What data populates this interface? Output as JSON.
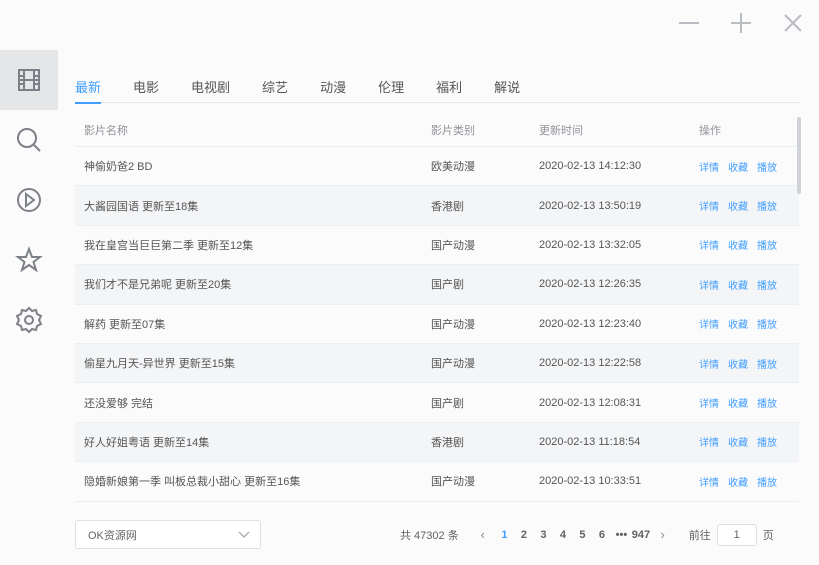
{
  "tabs": [
    "最新",
    "电影",
    "电视剧",
    "综艺",
    "动漫",
    "伦理",
    "福利",
    "解说"
  ],
  "active_tab": 0,
  "table": {
    "headers": {
      "name": "影片名称",
      "type": "影片类别",
      "time": "更新时间",
      "ops": "操作"
    },
    "ops_labels": {
      "detail": "详情",
      "fav": "收藏",
      "play": "播放"
    },
    "rows": [
      {
        "name": "神偷奶爸2 BD",
        "type": "欧美动漫",
        "time": "2020-02-13 14:12:30",
        "ops": true
      },
      {
        "name": "大酱园国语 更新至18集",
        "type": "香港剧",
        "time": "2020-02-13 13:50:19",
        "ops": true
      },
      {
        "name": "我在皇宫当巨巨第二季 更新至12集",
        "type": "国产动漫",
        "time": "2020-02-13 13:32:05",
        "ops": true
      },
      {
        "name": "我们才不是兄弟呢 更新至20集",
        "type": "国产剧",
        "time": "2020-02-13 12:26:35",
        "ops": true
      },
      {
        "name": "解药 更新至07集",
        "type": "国产动漫",
        "time": "2020-02-13 12:23:40",
        "ops": true
      },
      {
        "name": "偷星九月天-异世界 更新至15集",
        "type": "国产动漫",
        "time": "2020-02-13 12:22:58",
        "ops": true
      },
      {
        "name": "还没爱够 完结",
        "type": "国产剧",
        "time": "2020-02-13 12:08:31",
        "ops": true
      },
      {
        "name": "好人好姐粤语 更新至14集",
        "type": "香港剧",
        "time": "2020-02-13 11:18:54",
        "ops": true
      },
      {
        "name": "隐婚新娘第一季 叫板总裁小甜心 更新至16集",
        "type": "国产动漫",
        "time": "2020-02-13 10:33:51",
        "ops": true
      }
    ]
  },
  "footer": {
    "source_select": "OK资源网",
    "total": "共 47302 条",
    "pages": [
      "1",
      "2",
      "3",
      "4",
      "5",
      "6",
      "•••",
      "947"
    ],
    "active_page": 0,
    "goto_label": "前往",
    "goto_value": "1",
    "page_suffix": "页"
  },
  "sidebar": {
    "items": [
      "film-icon",
      "search-icon",
      "play-icon",
      "star-icon",
      "gear-icon"
    ],
    "active": 0
  },
  "colors": {
    "accent": "#409eff",
    "icon": "#7d8187",
    "row_alt": "#f4f5f7"
  }
}
